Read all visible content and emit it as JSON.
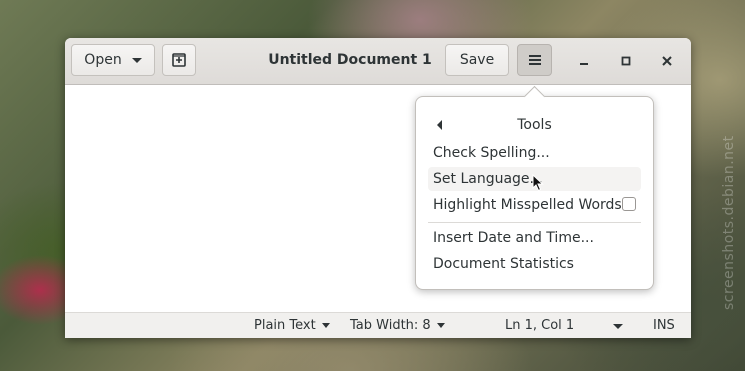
{
  "watermark": "screenshots.debian.net",
  "window": {
    "title": "Untitled Document 1",
    "open_label": "Open",
    "save_label": "Save"
  },
  "popover": {
    "title": "Tools",
    "items": [
      {
        "label": "Check Spelling..."
      },
      {
        "label": "Set Language..."
      },
      {
        "label": "Highlight Misspelled Words",
        "checked": false
      },
      {
        "label": "Insert Date and Time..."
      },
      {
        "label": "Document Statistics"
      }
    ]
  },
  "statusbar": {
    "language": "Plain Text",
    "tab_width": "Tab Width: 8",
    "position": "Ln 1, Col 1",
    "mode": "INS"
  }
}
